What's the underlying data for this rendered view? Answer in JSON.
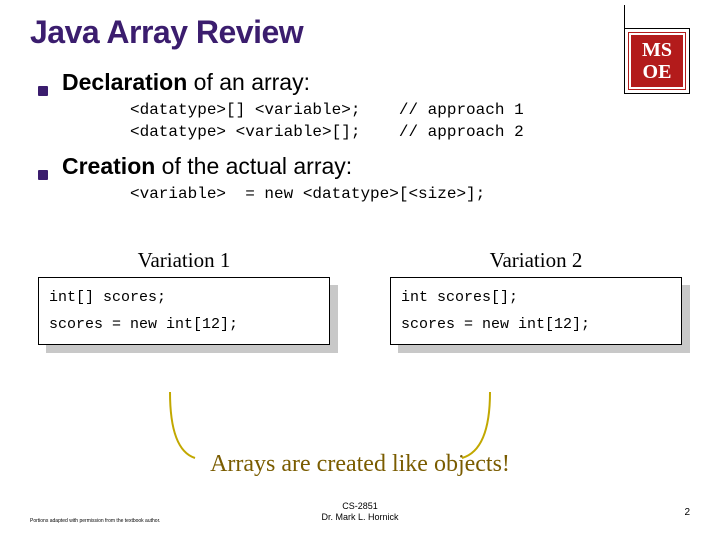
{
  "title": "Java Array Review",
  "logo": {
    "line1": "MS",
    "line2": "OE"
  },
  "bullets": [
    {
      "bold": "Declaration",
      "rest": " of an array:"
    },
    {
      "bold": "Creation",
      "rest": " of the actual array:"
    }
  ],
  "code_decl": "<datatype>[] <variable>;    // approach 1\n<datatype> <variable>[];    // approach 2",
  "code_creation": "<variable>  = new <datatype>[<size>];",
  "variations": {
    "left": {
      "label": "Variation 1",
      "code": "int[] scores;\nscores = new int[12];"
    },
    "right": {
      "label": "Variation 2",
      "code": "int scores[];\nscores = new int[12];"
    }
  },
  "callout": "Arrays  are created like objects!",
  "footer_left": "Portions adapted with permission from the textbook author.",
  "footer_center_1": "CS-2851",
  "footer_center_2": "Dr. Mark L. Hornick",
  "footer_right": "2"
}
